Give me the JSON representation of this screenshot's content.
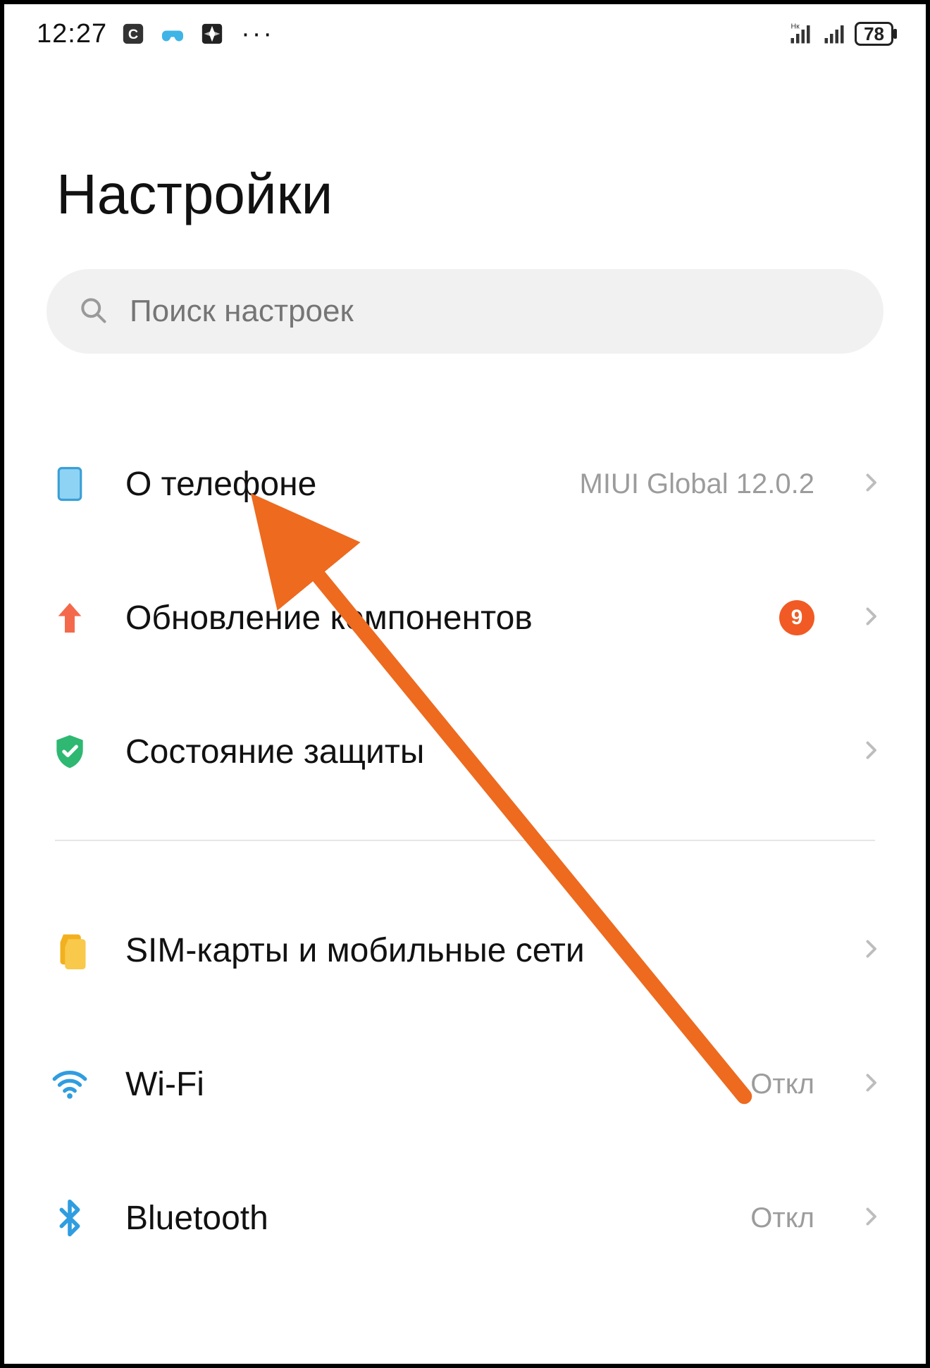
{
  "status": {
    "time": "12:27",
    "battery_level": "78"
  },
  "title": "Настройки",
  "search": {
    "placeholder": "Поиск настроек"
  },
  "items": {
    "about": {
      "label": "О телефоне",
      "value": "MIUI Global 12.0.2"
    },
    "updates": {
      "label": "Обновление компонентов",
      "badge": "9"
    },
    "security": {
      "label": "Состояние защиты"
    },
    "sim": {
      "label": "SIM-карты и мобильные сети"
    },
    "wifi": {
      "label": "Wi-Fi",
      "value": "Откл"
    },
    "bluetooth": {
      "label": "Bluetooth",
      "value": "Откл"
    }
  },
  "annotation": {
    "arrow_color": "#ed6a1f"
  }
}
